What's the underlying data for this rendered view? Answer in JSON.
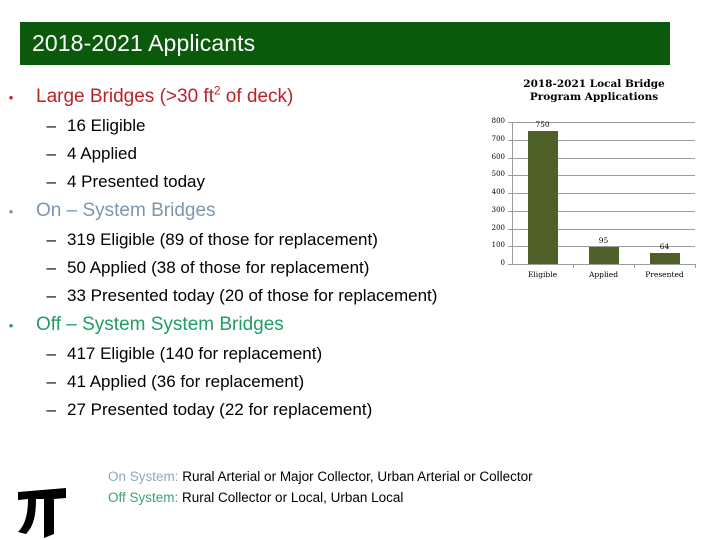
{
  "slide": {
    "title": "2018-2021 Applicants",
    "title_bar_color": "#0B5A0B"
  },
  "bullets": [
    {
      "label": "Large Bridges (>30 ft",
      "label_sup": "2",
      "label_tail": " of deck)",
      "color": "#BE2026",
      "marker": "•",
      "sub": [
        {
          "marker": "–",
          "text": "16 Eligible"
        },
        {
          "marker": "–",
          "text": "4 Applied"
        },
        {
          "marker": "–",
          "text": "4 Presented today"
        }
      ]
    },
    {
      "label": "On – System Bridges",
      "color": "#7D96B0",
      "marker": "•",
      "sub": [
        {
          "marker": "–",
          "text": "319 Eligible (89 of those for replacement)"
        },
        {
          "marker": "–",
          "text": "50 Applied (38 of those for replacement)"
        },
        {
          "marker": "–",
          "text": "33 Presented today (20 of those for replacement)"
        }
      ]
    },
    {
      "label": "Off – System System Bridges",
      "color": "#1F9D63",
      "marker": "•",
      "sub": [
        {
          "marker": "–",
          "text": "417 Eligible (140 for replacement)"
        },
        {
          "marker": "–",
          "text": "41 Applied (36 for replacement)"
        },
        {
          "marker": "–",
          "text": "27 Presented today (22 for replacement)"
        }
      ]
    }
  ],
  "footer": {
    "on_label": "On System:",
    "on_text": " Rural Arterial or Major Collector, Urban Arterial or Collector",
    "off_label": "Off System:",
    "off_text": " Rural Collector or Local, Urban Local",
    "on_color": "#8FA8C0",
    "off_color": "#3AA376",
    "logo_name": "txdot-pi-logo"
  },
  "chart_data": {
    "type": "bar",
    "title": "2018-2021 Local Bridge Program Applications",
    "title_line1": "2018-2021 Local Bridge",
    "title_line2": "Program Applications",
    "categories": [
      "Eligible",
      "Applied",
      "Presented"
    ],
    "values": [
      750,
      95,
      64
    ],
    "data_labels": [
      "750",
      "95",
      "64"
    ],
    "xlabel": "",
    "ylabel": "",
    "ylim": [
      0,
      800
    ],
    "yticks": [
      800,
      700,
      600,
      500,
      400,
      300,
      200,
      100,
      0
    ],
    "ytick_labels": [
      "800",
      "700",
      "600",
      "500",
      "400",
      "300",
      "200",
      "100",
      "0"
    ],
    "grid": true,
    "legend": false,
    "bar_color": "#4F5F28",
    "axis_color": "#9C9C9C"
  }
}
